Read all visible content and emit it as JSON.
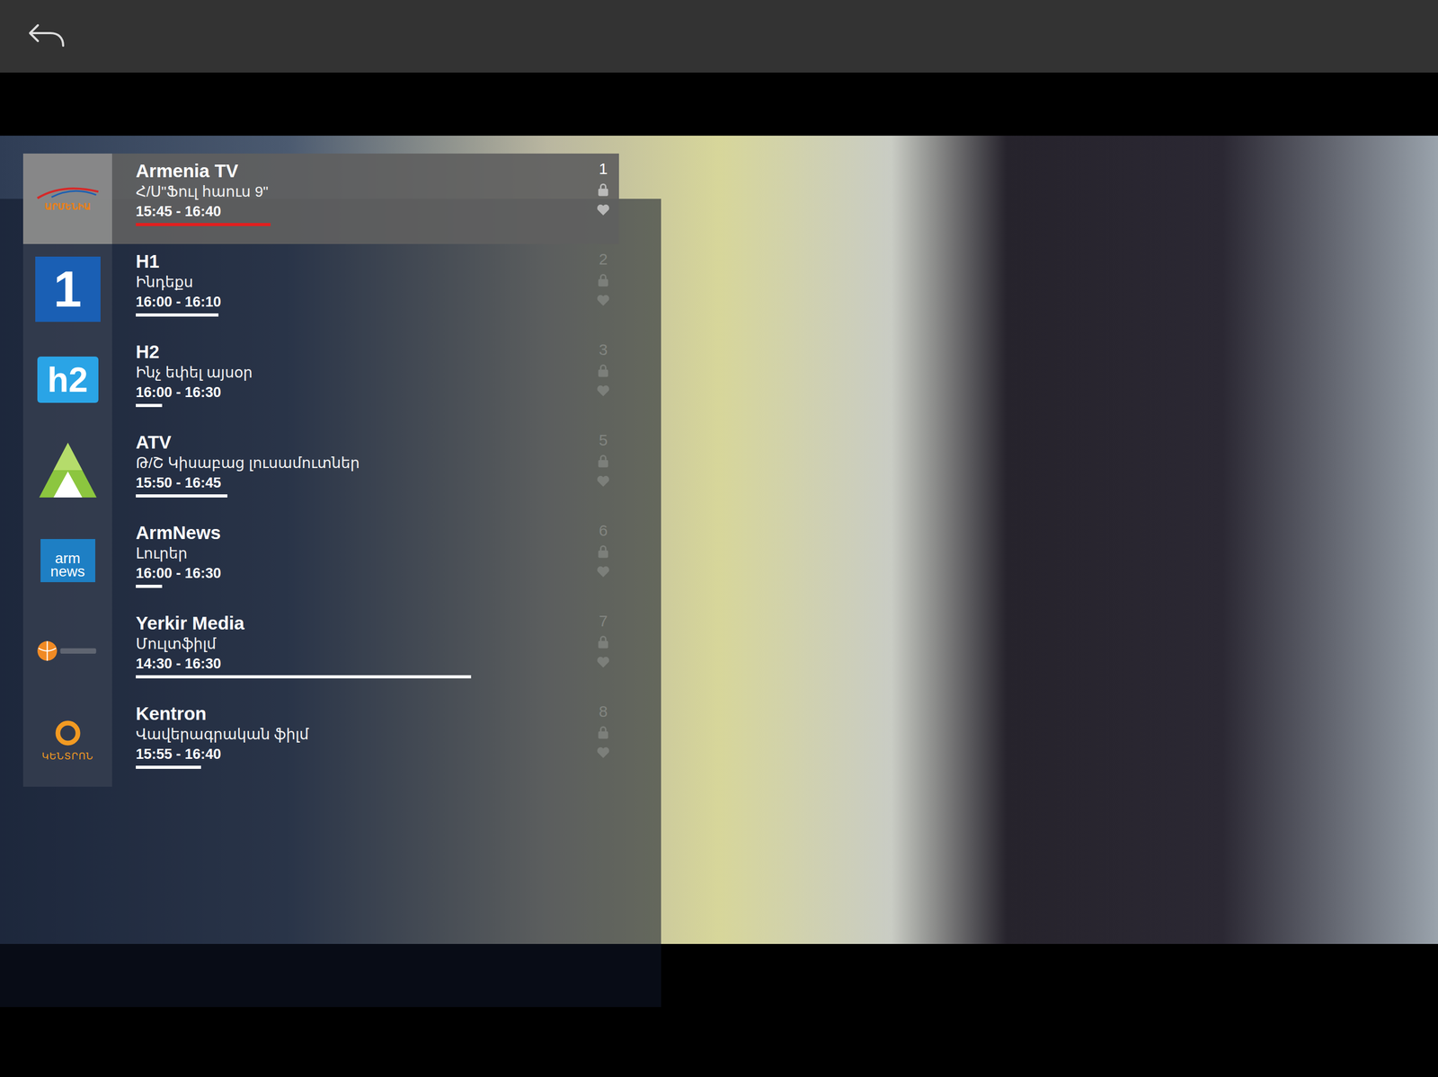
{
  "channels": [
    {
      "number": "1",
      "name": "Armenia TV",
      "logo_kind": "armenia",
      "logo_text": "ԱՐՄԵՆԻԱ",
      "program": "Հ/Ս\"Ֆուլ հաուս 9\"",
      "time": "15:45 - 16:40",
      "level": 0.31,
      "selected": true
    },
    {
      "number": "2",
      "name": "H1",
      "logo_kind": "h1",
      "logo_text": "1",
      "program": "Ինդեքս",
      "time": "16:00 - 16:10",
      "level": 0.19,
      "selected": false
    },
    {
      "number": "3",
      "name": "H2",
      "logo_kind": "h2",
      "logo_text": "h2",
      "program": "Ինչ եփել այսօր",
      "time": "16:00 - 16:30",
      "level": 0.06,
      "selected": false
    },
    {
      "number": "5",
      "name": "ATV",
      "logo_kind": "atv",
      "logo_text": "",
      "program": "Թ/Շ Կիսաբաց լուսամուտներ",
      "time": "15:50 - 16:45",
      "level": 0.21,
      "selected": false
    },
    {
      "number": "6",
      "name": "ArmNews",
      "logo_kind": "armnews",
      "logo_text": "arm news",
      "program": "Լուրեր",
      "time": "16:00 - 16:30",
      "level": 0.06,
      "selected": false
    },
    {
      "number": "7",
      "name": "Yerkir Media",
      "logo_kind": "yerkir",
      "logo_text": "",
      "program": "Մուլտֆիլմ",
      "time": "14:30 - 16:30",
      "level": 0.77,
      "selected": false
    },
    {
      "number": "8",
      "name": "Kentron",
      "logo_kind": "kentron",
      "logo_text": "ԿԵՆՏՐՈՆ",
      "program": "Վավերագրական ֆիլմ",
      "time": "15:55 - 16:40",
      "level": 0.15,
      "selected": false
    }
  ]
}
